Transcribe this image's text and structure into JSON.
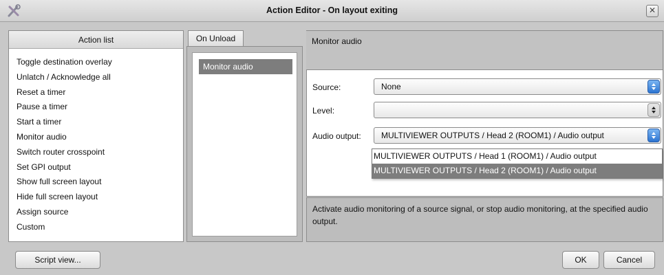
{
  "window": {
    "title": "Action Editor - On layout exiting"
  },
  "action_list": {
    "header": "Action list",
    "items": [
      "Toggle destination overlay",
      "Unlatch / Acknowledge all",
      "Reset a timer",
      "Pause a timer",
      "Start a timer",
      "Monitor audio",
      "Switch router crosspoint",
      "Set GPI output",
      "Show full screen layout",
      "Hide full screen layout",
      "Assign source",
      "Custom"
    ]
  },
  "event": {
    "tab_label": "On Unload",
    "items": [
      "Monitor audio"
    ]
  },
  "detail": {
    "title": "Monitor audio",
    "source": {
      "label": "Source:",
      "value": "None"
    },
    "level": {
      "label": "Level:",
      "value": ""
    },
    "audio_output": {
      "label": "Audio output:",
      "value": "MULTIVIEWER OUTPUTS / Head 2 (ROOM1) / Audio output",
      "options": [
        "MULTIVIEWER OUTPUTS / Head 1 (ROOM1) / Audio output",
        "MULTIVIEWER OUTPUTS / Head 2 (ROOM1) / Audio output"
      ]
    },
    "description": "Activate audio monitoring of a source signal, or stop audio monitoring, at the specified audio output."
  },
  "buttons": {
    "script_view": "Script view...",
    "ok": "OK",
    "cancel": "Cancel"
  },
  "colors": {
    "selection": "#7d7d7d",
    "accent_spinner": "#2c74d1"
  }
}
